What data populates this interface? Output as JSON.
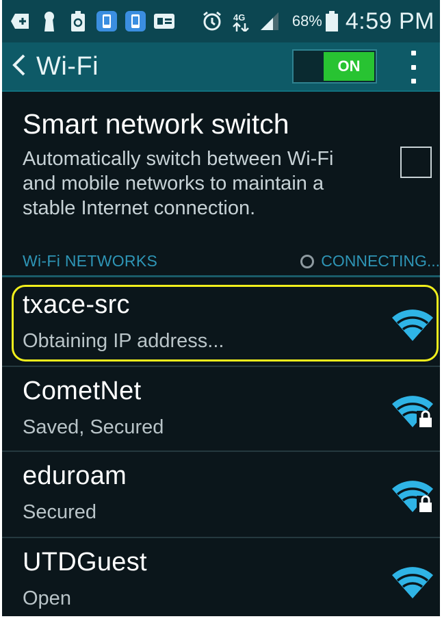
{
  "status_bar": {
    "icons": [
      "add-box-icon",
      "keyhole-icon",
      "recycle-battery-icon",
      "phone-update-icon",
      "phone-update-icon",
      "message-icon",
      "alarm-icon",
      "4g-signal-icon",
      "cell-signal-icon",
      "battery-icon"
    ],
    "network_type": "4G",
    "battery_percent": "68%",
    "time": "4:59 PM"
  },
  "action_bar": {
    "title": "Wi-Fi",
    "toggle_label": "ON",
    "toggle_on_color": "#28c332"
  },
  "smart_switch": {
    "title": "Smart network switch",
    "description": "Automatically switch between Wi-Fi and mobile networks to maintain a stable Internet connection.",
    "checked": false
  },
  "networks_section": {
    "title": "Wi-Fi NETWORKS",
    "status": "CONNECTING..."
  },
  "networks": [
    {
      "name": "txace-src",
      "status": "Obtaining IP address...",
      "locked": false,
      "highlighted": true
    },
    {
      "name": "CometNet",
      "status": "Saved, Secured",
      "locked": true,
      "highlighted": false
    },
    {
      "name": "eduroam",
      "status": "Secured",
      "locked": true,
      "highlighted": false
    },
    {
      "name": "UTDGuest",
      "status": "Open",
      "locked": false,
      "highlighted": false
    }
  ],
  "colors": {
    "status_bar_bg": "#0c4651",
    "action_bar_bg": "#0e5a67",
    "accent": "#2e95b6",
    "wifi_signal": "#2fb4e6",
    "highlight": "#f1ef1c",
    "background": "#0b161b"
  }
}
